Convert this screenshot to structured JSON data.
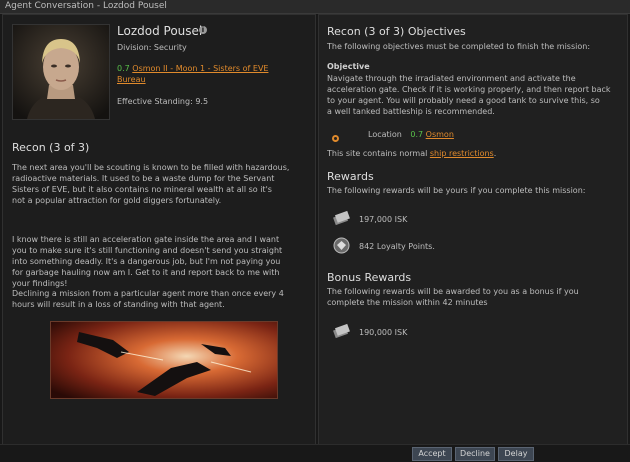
{
  "window": {
    "title": "Agent Conversation - Lozdod Pousel"
  },
  "agent": {
    "name": "Lozdod Pousel",
    "division": "Division: Security",
    "location_security": "0.7",
    "location_name": "Osmon II - Moon 1 - Sisters of EVE",
    "location_name_line2": "Bureau",
    "standing": "Effective Standing: 9.5"
  },
  "briefing": {
    "title": "Recon (3 of 3)",
    "paragraphs": [
      [
        "The next area you'll be scouting is known to be filled with hazardous,",
        "radioactive materials. It used to be a waste dump for the Servant",
        "Sisters of EVE, but it also contains no mineral wealth at all so it's",
        "not a popular attraction for gold diggers fortunately."
      ],
      [
        "I know there is still an acceleration gate inside the area and I want",
        "you to make sure it's still functioning and doesn't send you straight",
        "into something deadly. It's a dangerous job, but I'm not paying you",
        "for garbage hauling now am I. Get to it and report back to me with",
        "your findings!"
      ],
      [
        "Declining a mission from a particular agent more than once every 4",
        "hours will result in a loss of standing with that agent."
      ]
    ]
  },
  "objectives": {
    "title": "Recon (3 of 3) Objectives",
    "intro": "The following objectives must be completed to finish the mission:",
    "heading": "Objective",
    "text": [
      "Navigate through the irradiated environment and activate the",
      "acceleration gate. Check if it is working properly, and then report back",
      "to your agent. You will probably need a good tank to survive this, so",
      "a well tanked battleship is recommended."
    ],
    "location_label": "Location",
    "location_security": "0.7",
    "location_name": "Osmon",
    "restriction_prefix": "This site contains normal",
    "restriction_link": "ship restrictions",
    "restriction_suffix": "."
  },
  "rewards": {
    "title": "Rewards",
    "intro": "The following rewards will be yours if you complete this mission:",
    "items": [
      {
        "icon": "isk-icon",
        "label": "197,000 ISK"
      },
      {
        "icon": "loyalty-points-icon",
        "label": "842 Loyalty Points."
      }
    ]
  },
  "bonus": {
    "title": "Bonus Rewards",
    "intro": [
      "The following rewards will be awarded to you as a bonus if you",
      "complete the mission within 42 minutes"
    ],
    "items": [
      {
        "icon": "isk-icon",
        "label": "190,000 ISK"
      }
    ]
  },
  "buttons": {
    "accept": "Accept",
    "decline": "Decline",
    "delay": "Delay"
  },
  "colors": {
    "link": "#e08a2c",
    "security_high": "#59c04a",
    "button": "#3d4652"
  }
}
